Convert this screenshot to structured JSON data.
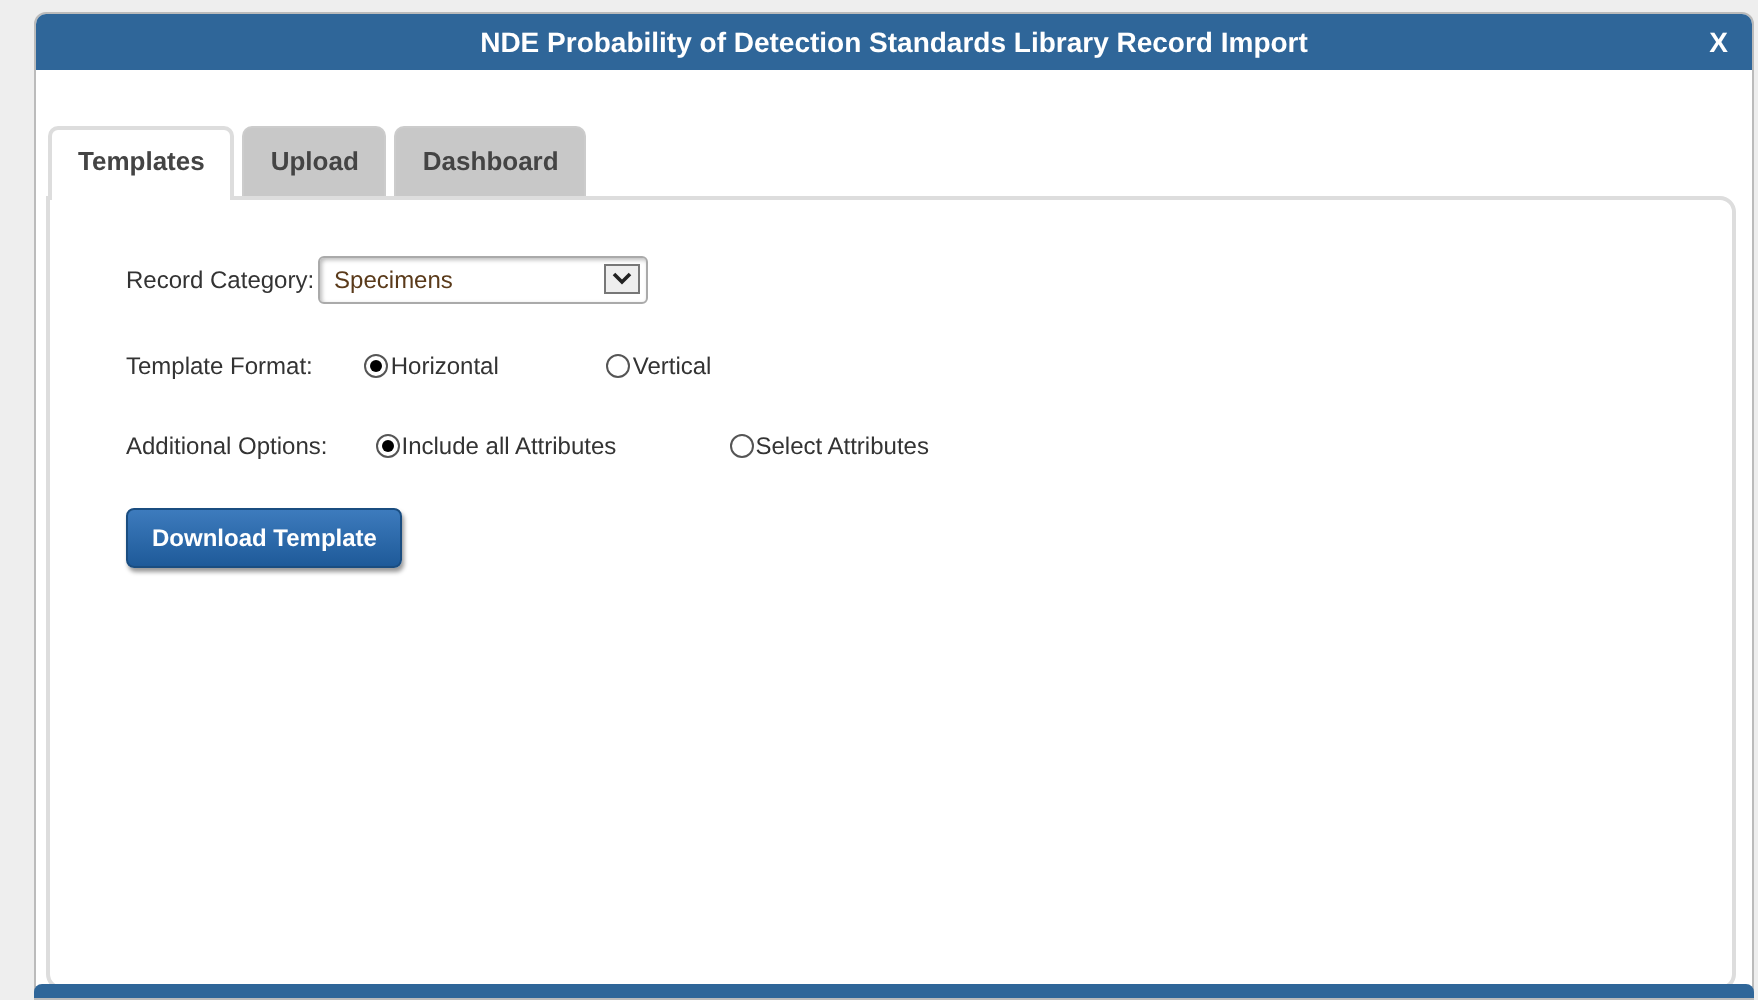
{
  "window": {
    "title": "NDE Probability of Detection Standards Library Record Import",
    "close": "X"
  },
  "tabs": [
    {
      "label": "Templates",
      "selected": true
    },
    {
      "label": "Upload",
      "selected": false
    },
    {
      "label": "Dashboard",
      "selected": false
    }
  ],
  "record_category": {
    "label": "Record Category:",
    "value": "Specimens"
  },
  "template_format": {
    "label": "Template Format:",
    "options": [
      {
        "label": "Horizontal",
        "selected": true
      },
      {
        "label": "Vertical",
        "selected": false
      }
    ]
  },
  "additional_options": {
    "label": "Additional Options:",
    "options": [
      {
        "label": "Include all Attributes",
        "selected": true
      },
      {
        "label": "Select Attributes",
        "selected": false
      }
    ]
  },
  "buttons": [
    "Download Template"
  ]
}
